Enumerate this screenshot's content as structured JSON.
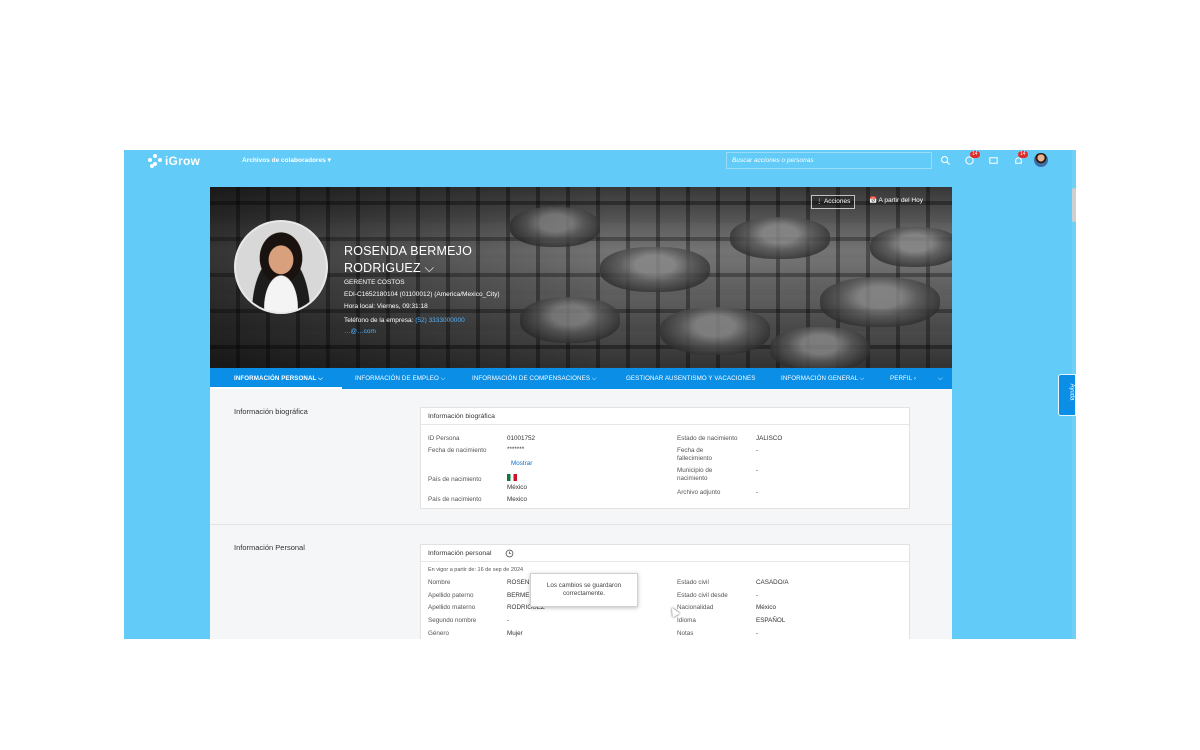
{
  "topbar": {
    "app_name": "iGrow",
    "menu_label": "Archivos de colaboradores ▾",
    "search_placeholder": "Buscar acciones o personas",
    "notification_count": "14",
    "alerts_count": "14"
  },
  "profile": {
    "name_line1": "ROSENDA BERMEJO",
    "name_line2": "RODRIGUEZ ⌵",
    "job_title": "GERENTE COSTOS",
    "employee_line": "EDI-C1652180104 (01100012) (America/Mexico_City)",
    "local_time": "Hora local: Viernes, 09:31:18",
    "phone_label": "Teléfono de la empresa:",
    "phone_value": "(52) 3333000000",
    "email_value": "…@…com",
    "actions_button": "⋮ Acciones",
    "date_button": "📅 A partir del Hoy"
  },
  "tabs": [
    {
      "label": "INFORMACIÓN PERSONAL ⌵"
    },
    {
      "label": "INFORMACIÓN DE EMPLEO ⌵"
    },
    {
      "label": "INFORMACIÓN DE COMPENSACIONES ⌵"
    },
    {
      "label": "GESTIONAR AUSENTISMO Y VACACIONES"
    },
    {
      "label": "INFORMACIÓN GENERAL ⌵"
    },
    {
      "label": "PERFIL ›"
    },
    {
      "label": "⌵"
    }
  ],
  "bio": {
    "section_label": "Información biográfica",
    "panel_title": "Información biográfica",
    "id_label": "ID Persona",
    "id_value": "01001752",
    "dob_label": "Fecha de nacimiento",
    "dob_value": "*******",
    "show_link": "Mostrar",
    "country_label": "País de nacimiento",
    "country_value": "México",
    "country2_label": "País de nacimiento",
    "country2_value": "Mexico",
    "state_label": "Estado de nacimiento",
    "state_value": "JALISCO",
    "death_label_1": "Fecha de",
    "death_label_2": "fallecimiento",
    "death_value": "-",
    "muni_label_1": "Municipio de",
    "muni_label_2": "nacimiento",
    "muni_value": "-",
    "attach_label": "Archivo adjunto",
    "attach_value": "-"
  },
  "personal": {
    "section_label": "Información Personal",
    "panel_title": "Información personal",
    "effective": "En vigor a partir de: 16 de sep de 2024",
    "nombre_label": "Nombre",
    "nombre_value": "ROSEN",
    "paterno_label": "Apellido paterno",
    "paterno_value": "BERME",
    "materno_label": "Apellido materno",
    "materno_value": "RODRIGUEZ",
    "segundo_label": "Segundo nombre",
    "segundo_value": "-",
    "genero_label": "Género",
    "genero_value": "Mujer",
    "civil_label": "Estado civil",
    "civil_value": "CASADO/A",
    "civil_desde_label": "Estado civil desde",
    "civil_desde_value": "-",
    "nacionalidad_label": "Nacionalidad",
    "nacionalidad_value": "México",
    "idioma_label": "Idioma",
    "idioma_value": "ESPAÑOL",
    "notas_label": "Notas",
    "notas_value": "-"
  },
  "toast": {
    "line1": "Los cambios se guardaron",
    "line2": "correctamente."
  },
  "help_tab": "Ayuda",
  "colors": {
    "background": "#62cbf7",
    "tabbar": "#0a8ee6",
    "badge": "#e02b2b",
    "link": "#4fb3ff"
  }
}
